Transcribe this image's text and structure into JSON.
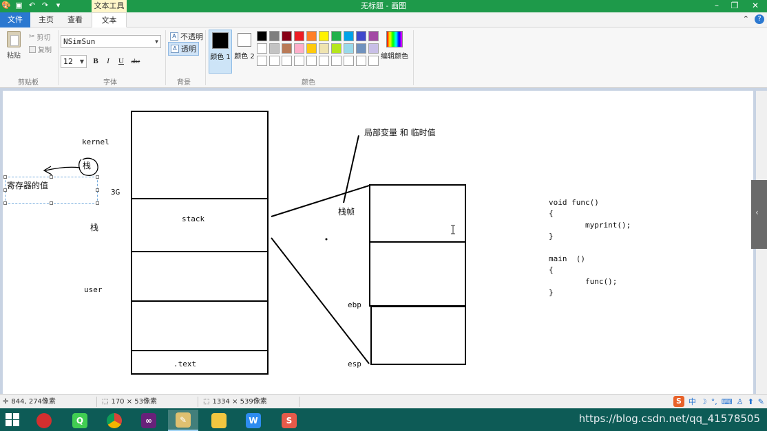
{
  "window": {
    "title": "无标题 - 画图",
    "context_tab": "文本工具",
    "controls": [
      "–",
      "❐",
      "✕"
    ]
  },
  "tabs": [
    {
      "label": "文件"
    },
    {
      "label": "主页"
    },
    {
      "label": "查看"
    },
    {
      "label": "文本"
    }
  ],
  "ribbon": {
    "clipboard": {
      "paste": "粘贴",
      "cut": "剪切",
      "copy": "复制",
      "group": "剪贴板"
    },
    "font": {
      "family": "NSimSun",
      "size": "12",
      "bold": "B",
      "italic": "I",
      "underline": "U",
      "strike": "abc",
      "group": "字体"
    },
    "background": {
      "opaque": "不透明",
      "transparent": "透明",
      "group": "背景"
    },
    "colors": {
      "color1": "颜色 1",
      "color2": "颜色 2",
      "edit": "编辑颜色",
      "group": "颜色",
      "color1_value": "#000000",
      "color2_value": "#ffffff",
      "palette": [
        "#000000",
        "#7f7f7f",
        "#880015",
        "#ed1c24",
        "#ff7f27",
        "#fff200",
        "#22b14c",
        "#00a2e8",
        "#3f48cc",
        "#a349a4",
        "#ffffff",
        "#c3c3c3",
        "#b97a57",
        "#ffaec9",
        "#ffc90e",
        "#efe4b0",
        "#b5e61d",
        "#99d9ea",
        "#7092be",
        "#c8bfe7",
        "#ffffff",
        "#ffffff",
        "#ffffff",
        "#ffffff",
        "#ffffff",
        "#ffffff",
        "#ffffff",
        "#ffffff",
        "#ffffff",
        "#ffffff"
      ]
    }
  },
  "canvas": {
    "labels": {
      "kernel": "kernel",
      "stack_circled": "栈",
      "register_value": "寄存器的值",
      "g3": "3G",
      "stack_cn": "栈",
      "user": "user",
      "stack_block": "stack",
      "text_block": ".text",
      "local_vars": "局部变量 和 临时值",
      "stack_frame": "栈帧",
      "ebp": "ebp",
      "esp": "esp"
    },
    "code": [
      "void func()",
      "{",
      "        myprint();",
      "}",
      "",
      "main  ()",
      "{",
      "        func();",
      "}"
    ]
  },
  "statusbar": {
    "cursor_pos": "844, 274像素",
    "selection_size": "170 × 53像素",
    "image_size": "1334 × 539像素"
  },
  "ime": {
    "logo": "S",
    "mode": "中"
  },
  "taskbar": {
    "apps": [
      "red-ball",
      "qt",
      "chrome",
      "visual-studio",
      "paint",
      "file-explorer",
      "wps",
      "slides"
    ],
    "watermark": "https://blog.csdn.net/qq_41578505"
  }
}
